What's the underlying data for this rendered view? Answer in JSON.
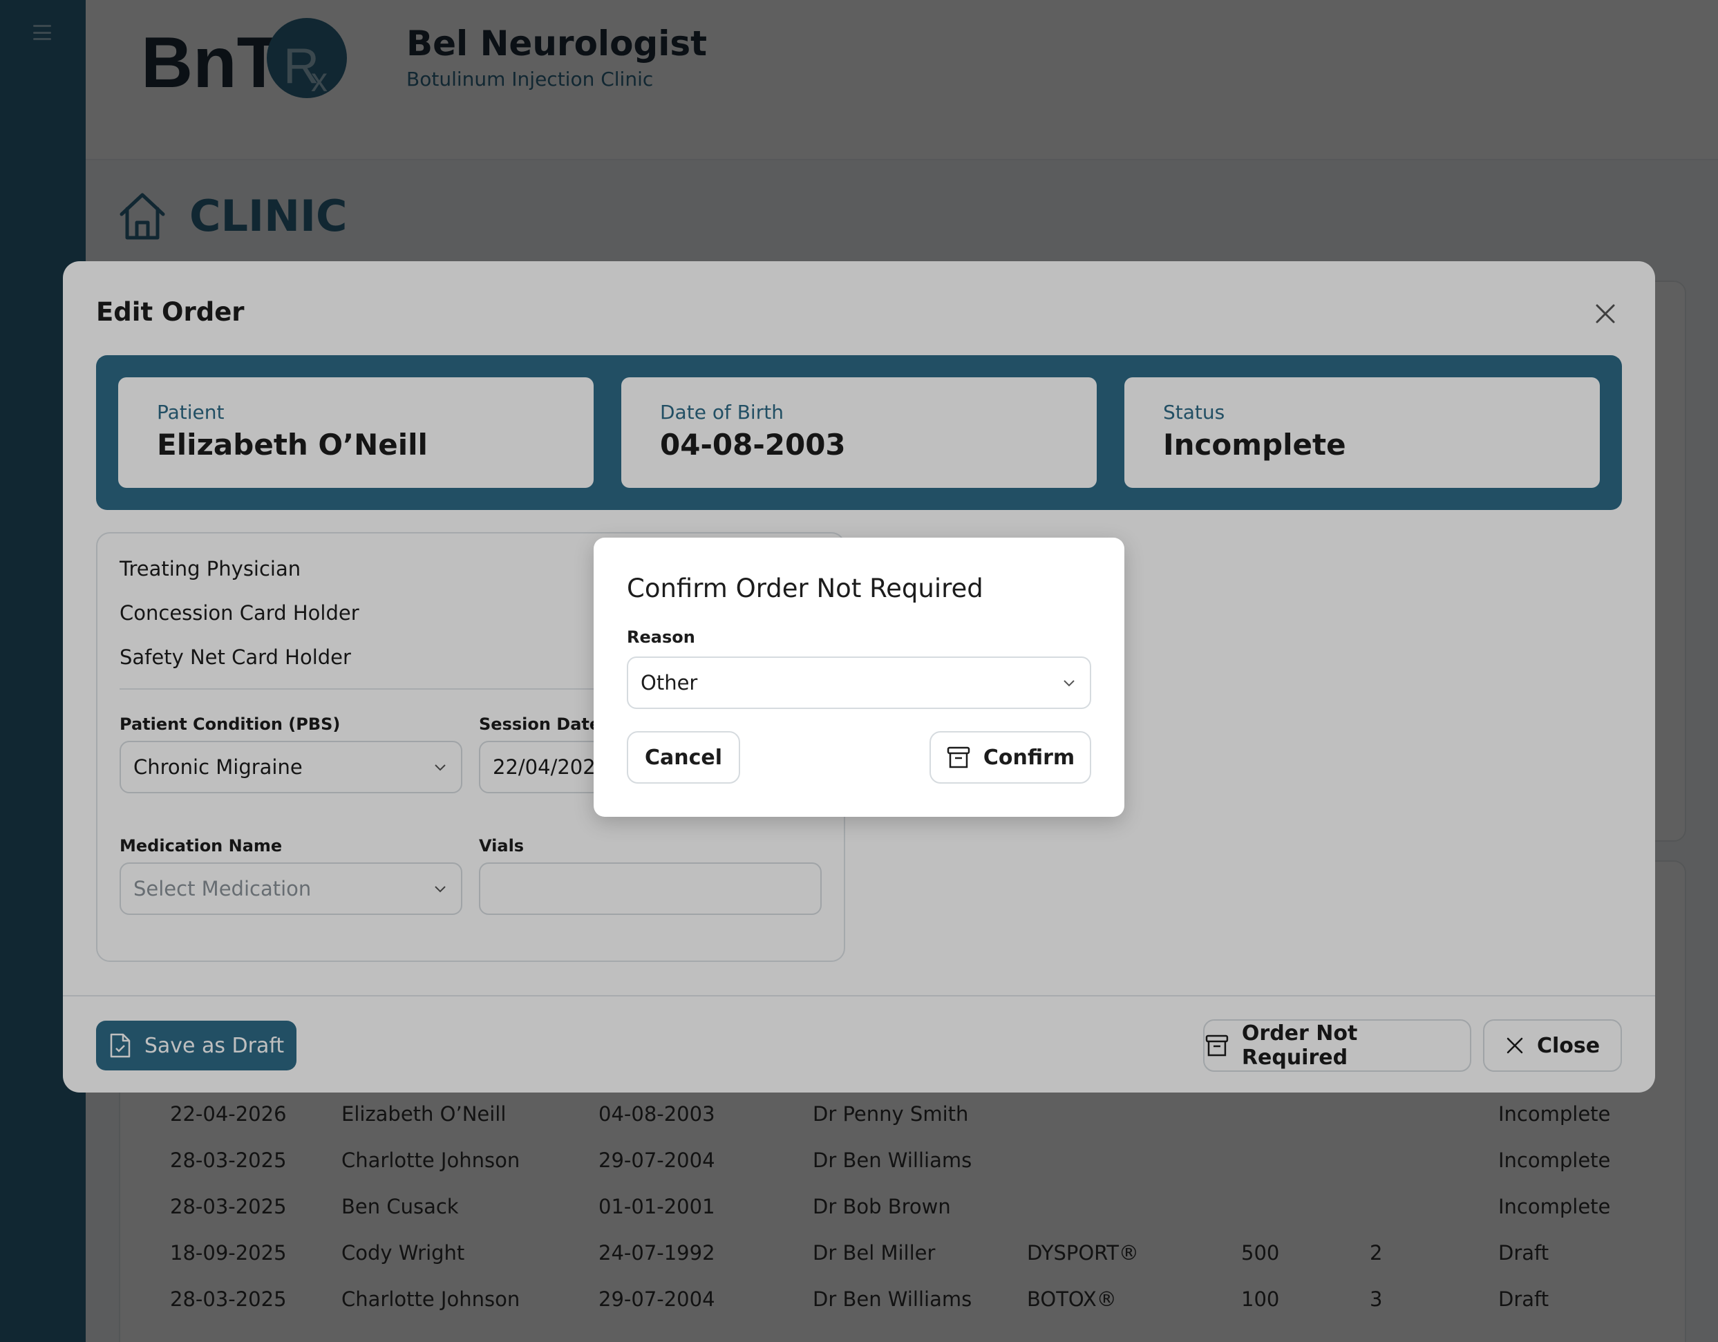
{
  "brand": {
    "logo_text": "BnT Rx",
    "title": "Bel Neurologist",
    "subtitle": "Botulinum Injection Clinic"
  },
  "page": {
    "title": "CLINIC",
    "icon": "home-icon"
  },
  "background_table": {
    "rows": [
      {
        "session_date": "22-04-2026",
        "patient": "Elizabeth O’Neill",
        "dob": "04-08-2003",
        "physician": "Dr Penny Smith",
        "medication": "",
        "dose": "",
        "vials": "",
        "status": "Incomplete"
      },
      {
        "session_date": "28-03-2025",
        "patient": "Charlotte Johnson",
        "dob": "29-07-2004",
        "physician": "Dr Ben Williams",
        "medication": "",
        "dose": "",
        "vials": "",
        "status": "Incomplete"
      },
      {
        "session_date": "28-03-2025",
        "patient": "Ben Cusack",
        "dob": "01-01-2001",
        "physician": "Dr Bob Brown",
        "medication": "",
        "dose": "",
        "vials": "",
        "status": "Incomplete"
      },
      {
        "session_date": "18-09-2025",
        "patient": "Cody Wright",
        "dob": "24-07-1992",
        "physician": "Dr Bel Miller",
        "medication": "DYSPORT®",
        "dose": "500",
        "vials": "2",
        "status": "Draft"
      },
      {
        "session_date": "28-03-2025",
        "patient": "Charlotte Johnson",
        "dob": "29-07-2004",
        "physician": "Dr Ben Williams",
        "medication": "BOTOX®",
        "dose": "100",
        "vials": "3",
        "status": "Draft"
      }
    ]
  },
  "modal": {
    "title": "Edit Order",
    "patient": {
      "label": "Patient",
      "value": "Elizabeth O’Neill"
    },
    "dob": {
      "label": "Date of Birth",
      "value": "04-08-2003"
    },
    "status": {
      "label": "Status",
      "value": "Incomplete"
    },
    "form": {
      "treating_physician_label": "Treating Physician",
      "concession_label": "Concession Card Holder",
      "safety_net_label": "Safety Net Card Holder",
      "condition_label": "Patient Condition (PBS)",
      "condition_value": "Chronic Migraine",
      "session_date_label": "Session Date",
      "session_date_value": "22/04/2026",
      "medication_label": "Medication Name",
      "medication_placeholder": "Select Medication",
      "vials_label": "Vials",
      "vials_value": ""
    },
    "footer": {
      "save_draft": "Save as Draft",
      "order_not_required": "Order Not Required",
      "close": "Close"
    }
  },
  "dialog": {
    "title": "Confirm Order Not Required",
    "reason_label": "Reason",
    "reason_value": "Other",
    "cancel": "Cancel",
    "confirm": "Confirm"
  },
  "colors": {
    "primary": "#2e6a86",
    "text": "#1c1c1c",
    "border": "#d6dbdf"
  }
}
